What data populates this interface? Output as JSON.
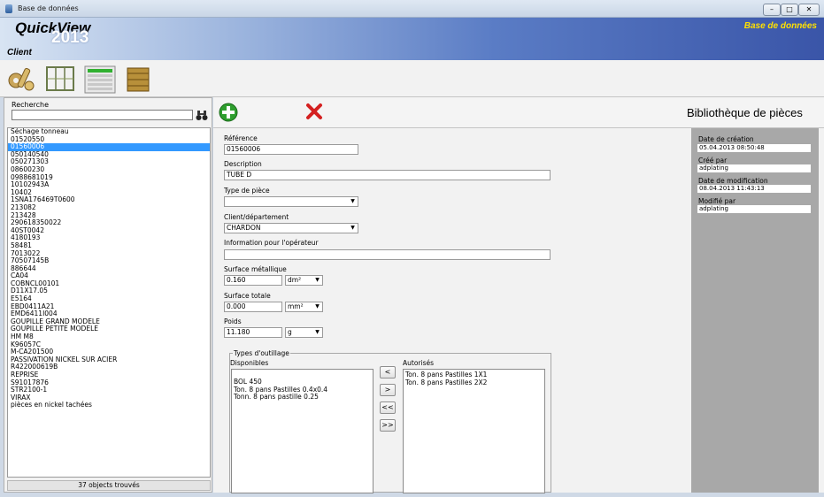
{
  "window": {
    "title": "Base de données"
  },
  "banner": {
    "brand": "QuickView",
    "year": "2013",
    "module": "Client",
    "database": "Base de données"
  },
  "toolbar": {
    "icons": [
      "pieces-icon",
      "racks-icon",
      "list-icon",
      "barrels-icon"
    ]
  },
  "search": {
    "label": "Recherche",
    "value": ""
  },
  "list": {
    "items": [
      "Séchage tonneau",
      "01520550",
      "01560006",
      "050140540",
      "050271303",
      "08600230",
      "0988681019",
      "10102943A",
      "10402",
      "1SNA176469T0600",
      "213082",
      "213428",
      "290618350022",
      "40ST0042",
      "4180193",
      "58481",
      "7013022",
      "70507145B",
      "886644",
      "CA04",
      "COBNCL00101",
      "D11X17.05",
      "E5164",
      "EBD0411A21",
      "EMD6411I004",
      "GOUPILLE GRAND MODELE",
      "GOUPILLE PETITE MODELE",
      "HM M8",
      "K96057C",
      "M-CA201500",
      "PASSIVATION NICKEL SUR ACIER",
      "R422000619B",
      "REPRISE",
      "S91017876",
      "STR2100-1",
      "VIRAX",
      "pièces en nickel   tachées"
    ],
    "selected": 2,
    "count_text": "37 objects trouvés"
  },
  "main": {
    "title": "Bibliothèque de pièces",
    "reference": {
      "label": "Référence",
      "value": "01560006"
    },
    "description": {
      "label": "Description",
      "value": "TUBE  D"
    },
    "type_piece": {
      "label": "Type de pièce",
      "value": ""
    },
    "client": {
      "label": "Client/département",
      "value": "CHARDON"
    },
    "info_operateur": {
      "label": "Information pour l'opérateur",
      "value": ""
    },
    "surface_metallique": {
      "label": "Surface métallique",
      "value": "0.160",
      "unit": "dm²"
    },
    "surface_totale": {
      "label": "Surface totale",
      "value": "0.000",
      "unit": "mm²"
    },
    "poids": {
      "label": "Poids",
      "value": "11.180",
      "unit": "g"
    },
    "outillage": {
      "title": "Types d'outillage",
      "available_label": "Disponibles",
      "available": [
        "BOL 450",
        "Ton. 8 pans Pastilles 0.4x0.4",
        "Tonn. 8 pans  pastille 0.25"
      ],
      "authorized_label": "Autorisés",
      "authorized": [
        "Ton. 8 pans Pastilles 1X1",
        "Ton. 8 pans Pastilles 2X2"
      ],
      "buttons": [
        "<",
        ">",
        "<<",
        ">>"
      ]
    }
  },
  "meta": {
    "date_creation": {
      "label": "Date de création",
      "value": "05.04.2013 08:50:48"
    },
    "cree_par": {
      "label": "Créé par",
      "value": "adplating"
    },
    "date_modification": {
      "label": "Date de modification",
      "value": "08.04.2013 11:43:13"
    },
    "modifie_par": {
      "label": "Modifié par",
      "value": "adplating"
    }
  },
  "colors": {
    "selection": "#3399ff",
    "banner_accent": "#ffe000",
    "add": "#2e9e2e",
    "delete": "#d42020"
  }
}
